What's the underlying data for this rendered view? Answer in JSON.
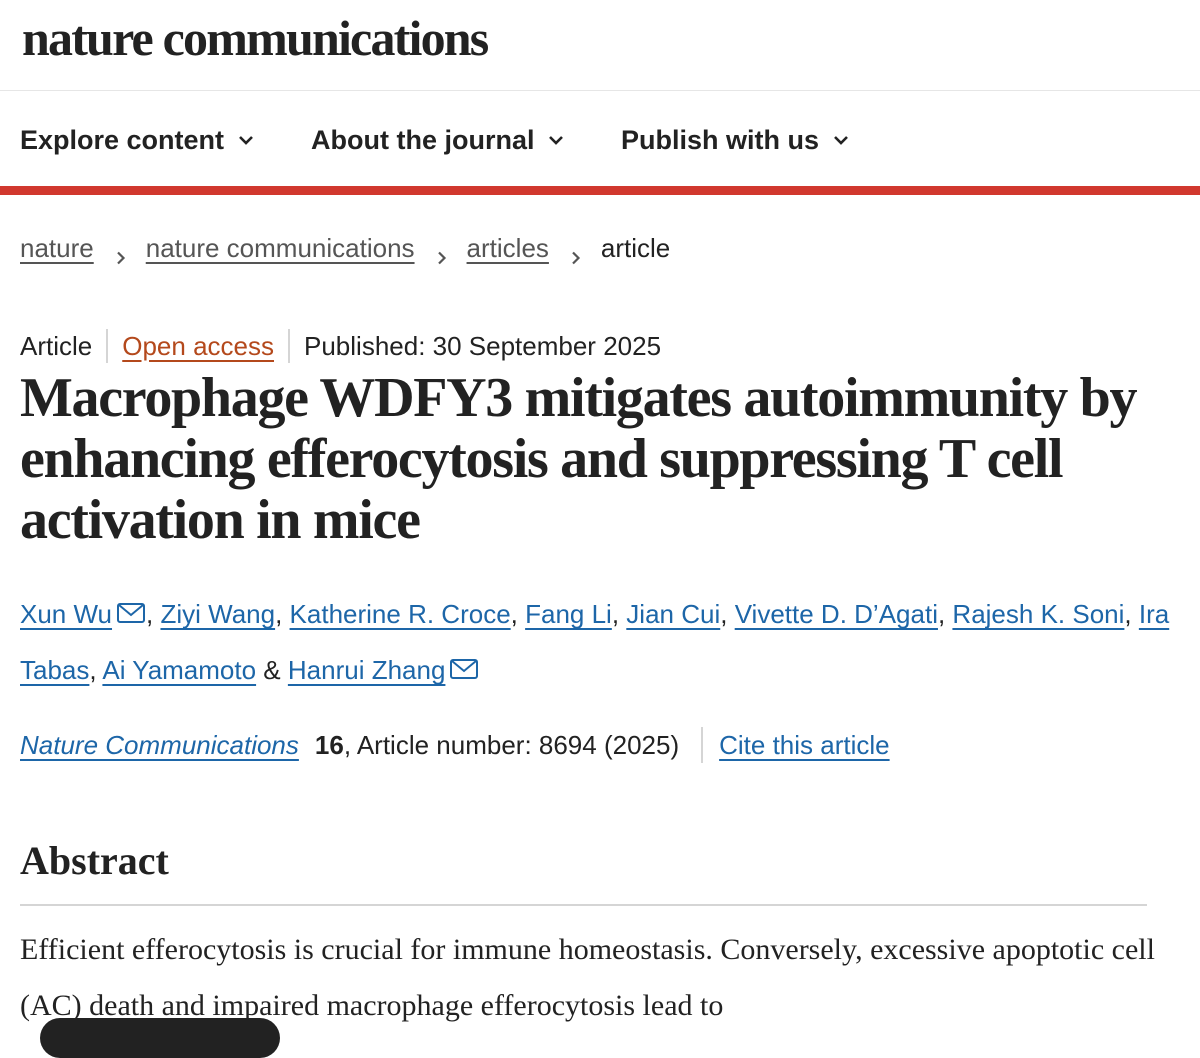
{
  "header": {
    "logo_text": "nature communications"
  },
  "nav": {
    "items": [
      {
        "label": "Explore content",
        "icon": "chevron-down-icon"
      },
      {
        "label": "About the journal",
        "icon": "chevron-down-icon"
      },
      {
        "label": "Publish with us",
        "icon": "chevron-down-icon"
      }
    ]
  },
  "colors": {
    "accent_bar": "#d1382e",
    "link": "#1d66a8",
    "open_access": "#b4491c",
    "text": "#222222"
  },
  "breadcrumbs": {
    "items": [
      "nature",
      "nature communications",
      "articles"
    ],
    "current": "article",
    "separator_icon": "chevron-right-icon"
  },
  "article": {
    "type": "Article",
    "access": "Open access",
    "published": "Published: 30 September 2025",
    "title": "Macrophage WDFY3 mitigates autoimmunity by enhancing efferocytosis and suppressing T cell activation in mice",
    "authors": [
      {
        "name": "Xun Wu",
        "icon": "envelope-icon"
      },
      {
        "name": "Ziyi Wang"
      },
      {
        "name": "Katherine R. Croce"
      },
      {
        "name": "Fang Li"
      },
      {
        "name": "Jian Cui"
      },
      {
        "name": "Vivette D. D’Agati"
      },
      {
        "name": "Rajesh K. Soni"
      },
      {
        "name": "Ira Tabas"
      },
      {
        "name": "Ai Yamamoto"
      },
      {
        "name": "Hanrui Zhang",
        "icon": "envelope-icon"
      }
    ],
    "author_separator": ", ",
    "author_final_separator": " & ",
    "citation": {
      "journal": "Nature Communications",
      "volume": "16",
      "article_number": ", Article number: 8694 (2025)",
      "cite_label": "Cite this article"
    }
  },
  "abstract": {
    "heading": "Abstract",
    "text": "Efficient efferocytosis is crucial for immune homeostasis. Conversely, excessive apoptotic cell (AC) death and impaired macrophage efferocytosis lead to"
  }
}
